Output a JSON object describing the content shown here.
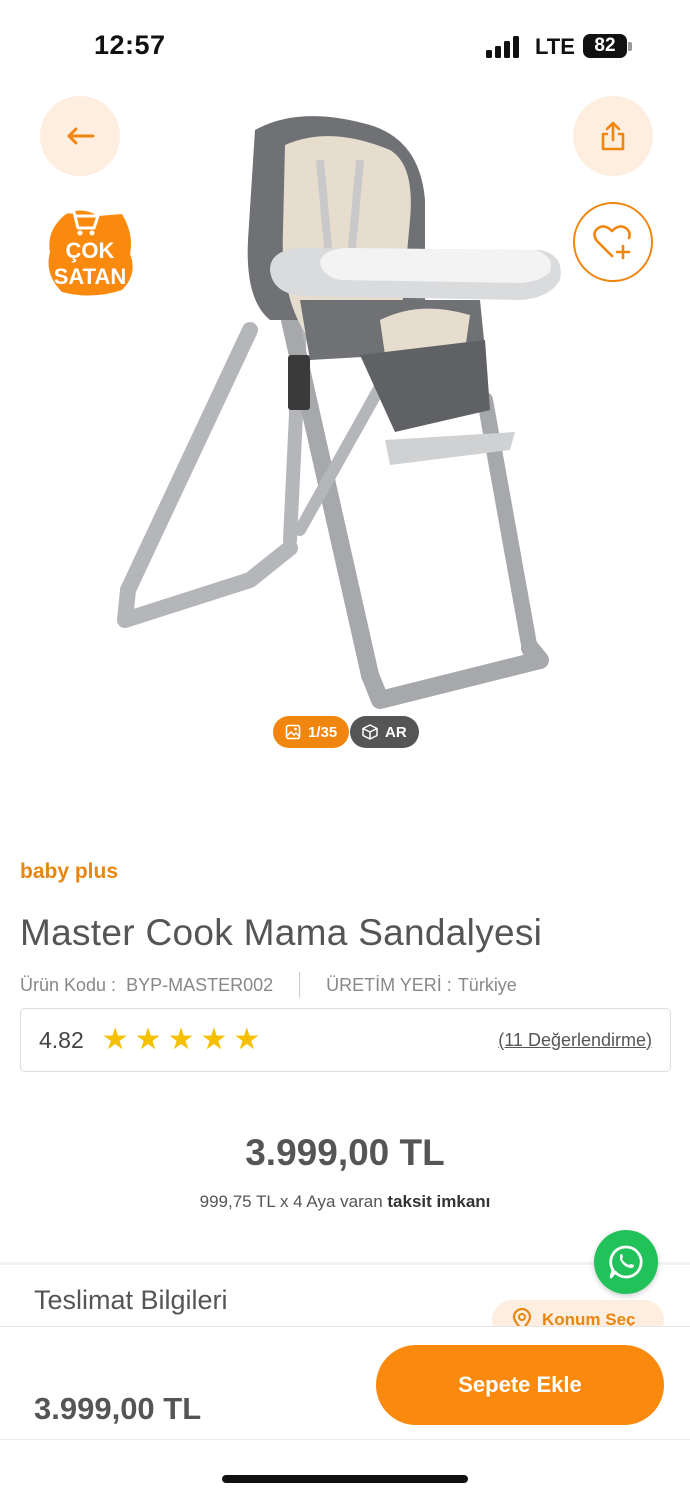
{
  "status_bar": {
    "time": "12:57",
    "network": "LTE",
    "battery": "82"
  },
  "hero": {
    "badge_text": [
      "ÇOK",
      "SATAN"
    ],
    "image_counter": "1/35",
    "ar_label": "AR"
  },
  "product": {
    "brand": "baby plus",
    "title": "Master Cook Mama Sandalyesi",
    "code_label": "Ürün Kodu :",
    "code_value": "BYP-MASTER002",
    "origin_label": "ÜRETİM YERİ :",
    "origin_value": "Türkiye",
    "rating": "4.82",
    "stars": 5,
    "reviews": "(11 Değerlendirme)",
    "price": "3.999,00 TL",
    "installment_prefix": "999,75 TL x 4 Aya varan",
    "installment_bold": "taksit imkanı"
  },
  "delivery": {
    "title": "Teslimat Bilgileri",
    "location_label": "Konum Seç"
  },
  "bottom_bar": {
    "price": "3.999,00 TL",
    "add_to_cart": "Sepete Ekle"
  },
  "colors": {
    "accent": "#f98a0e",
    "whatsapp": "#22c25a",
    "text": "#555555",
    "star": "#f5c000"
  },
  "icons": [
    "back-arrow-icon",
    "share-icon",
    "heart-plus-icon",
    "cart-icon",
    "image-icon",
    "cube-icon",
    "whatsapp-icon",
    "location-pin-icon"
  ]
}
